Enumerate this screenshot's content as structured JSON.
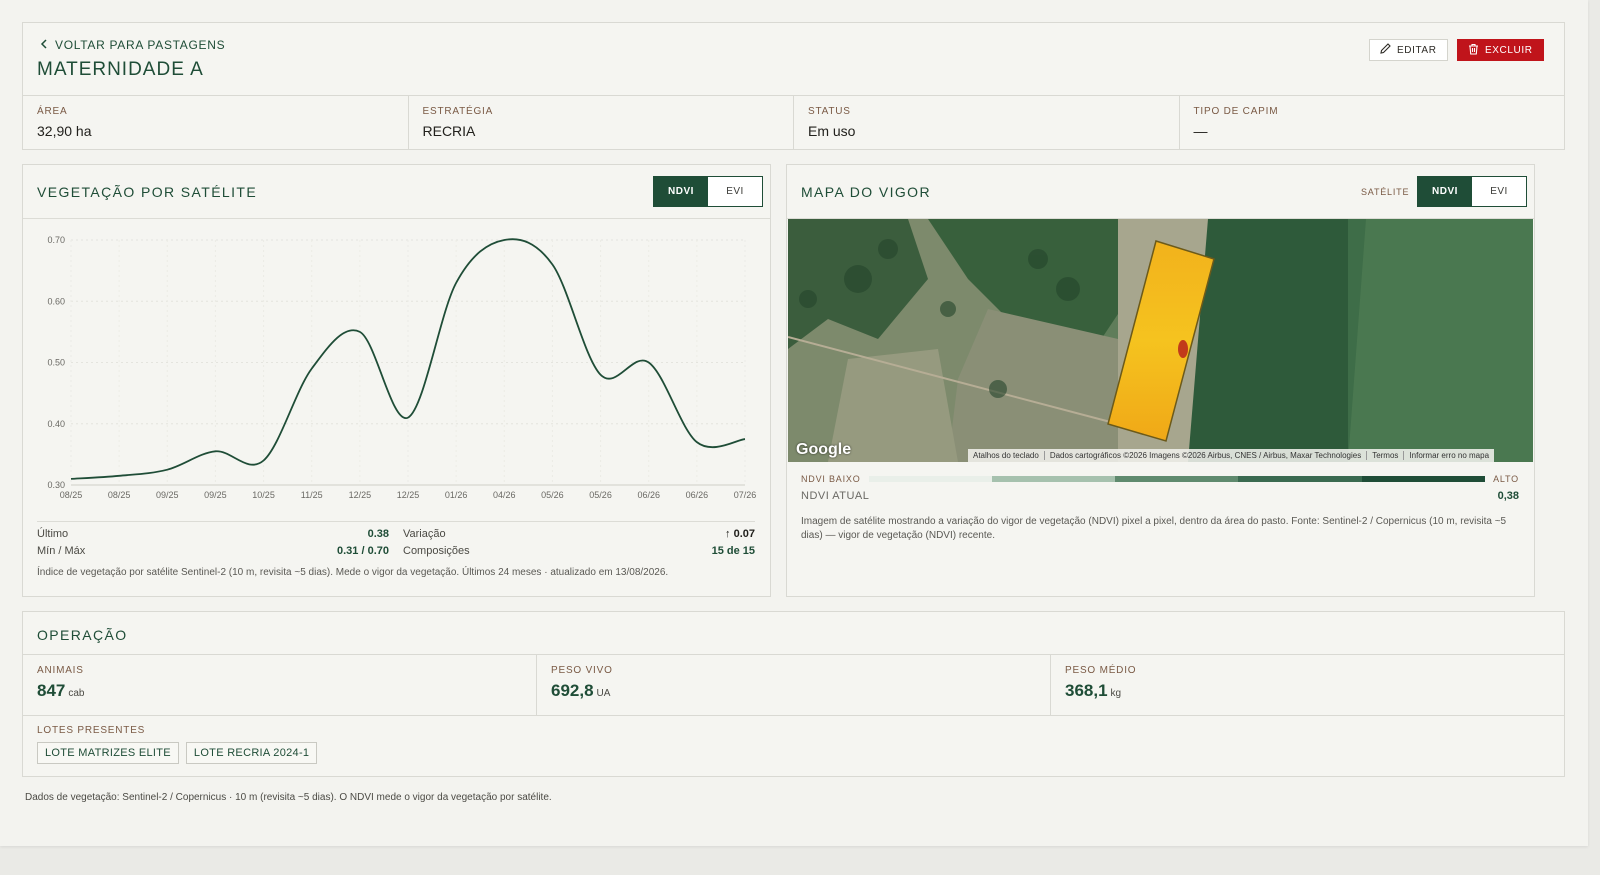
{
  "header": {
    "back_label": "VOLTAR PARA PASTAGENS",
    "title": "MATERNIDADE A",
    "edit_label": "EDITAR",
    "delete_label": "EXCLUIR"
  },
  "stats": [
    {
      "label": "ÁREA",
      "value": "32,90 ha"
    },
    {
      "label": "ESTRATÉGIA",
      "value": "RECRIA"
    },
    {
      "label": "STATUS",
      "value": "Em uso"
    },
    {
      "label": "TIPO DE CAPIM",
      "value": "—"
    }
  ],
  "vegetation": {
    "title": "VEGETAÇÃO POR SATÉLITE",
    "toggle": [
      "NDVI",
      "EVI"
    ],
    "active": "NDVI",
    "summary": {
      "ultimo_label": "Último",
      "ultimo_value": "0.38",
      "variacao_label": "Variação",
      "variacao_value": "↑ 0.07",
      "minmax_label": "Mín / Máx",
      "minmax_value": "0.31 / 0.70",
      "composicoes_label": "Composições",
      "composicoes_value": "15 de 15"
    },
    "note": "Índice de vegetação por satélite Sentinel-2 (10 m, revisita ~5 dias). Mede o vigor da vegetação. Últimos 24 meses · atualizado em 13/08/2026."
  },
  "chart_data": {
    "type": "line",
    "x": [
      "08/25",
      "08/25",
      "09/25",
      "09/25",
      "10/25",
      "11/25",
      "12/25",
      "12/25",
      "01/26",
      "04/26",
      "05/26",
      "05/26",
      "06/26",
      "06/26",
      "07/26"
    ],
    "series": [
      {
        "values": [
          0.31,
          0.315,
          0.325,
          0.355,
          0.34,
          0.49,
          0.55,
          0.41,
          0.63,
          0.7,
          0.66,
          0.48,
          0.5,
          0.37,
          0.375
        ]
      }
    ],
    "ylim": [
      0.3,
      0.7
    ],
    "yticks": [
      "0.70",
      "0.60",
      "0.50",
      "0.40",
      "0.30"
    ],
    "grid": true,
    "color": "#1f4d37"
  },
  "vigor": {
    "title": "MAPA DO VIGOR",
    "satellite_label": "SATÉLITE",
    "toggle": [
      "NDVI",
      "EVI"
    ],
    "active": "NDVI",
    "map_logo": "Google",
    "map_links": [
      "Atalhos do teclado",
      "Dados cartográficos ©2026 Imagens ©2026 Airbus, CNES / Airbus, Maxar Technologies",
      "Termos",
      "Informar erro no mapa"
    ],
    "legend_low": "NDVI BAIXO",
    "legend_high": "ALTO",
    "legend_colors": [
      "#e9efe9",
      "#a6c1ae",
      "#5f8a6e",
      "#3a6a50",
      "#1f4d37"
    ],
    "current_label": "NDVI ATUAL",
    "current_value": "0,38",
    "note": "Imagem de satélite mostrando a variação do vigor de vegetação (NDVI) pixel a pixel, dentro da área do pasto. Fonte: Sentinel-2 / Copernicus (10 m, revisita ~5 dias) — vigor de vegetação (NDVI) recente."
  },
  "operation": {
    "title": "OPERAÇÃO",
    "metrics": [
      {
        "label": "ANIMAIS",
        "value": "847",
        "unit": "cab"
      },
      {
        "label": "PESO VIVO",
        "value": "692,8",
        "unit": "UA"
      },
      {
        "label": "PESO MÉDIO",
        "value": "368,1",
        "unit": "kg"
      }
    ],
    "lotes_label": "LOTES PRESENTES",
    "lotes": [
      "LOTE MATRIZES ELITE",
      "LOTE RECRIA 2024-1"
    ]
  },
  "footer": "Dados de vegetação: Sentinel-2 / Copernicus · 10 m (revisita ~5 dias). O NDVI mede o vigor da vegetação por satélite.",
  "colors": {
    "brand": "#1f4d37",
    "danger": "#c0141b",
    "label": "#7a5a45"
  }
}
